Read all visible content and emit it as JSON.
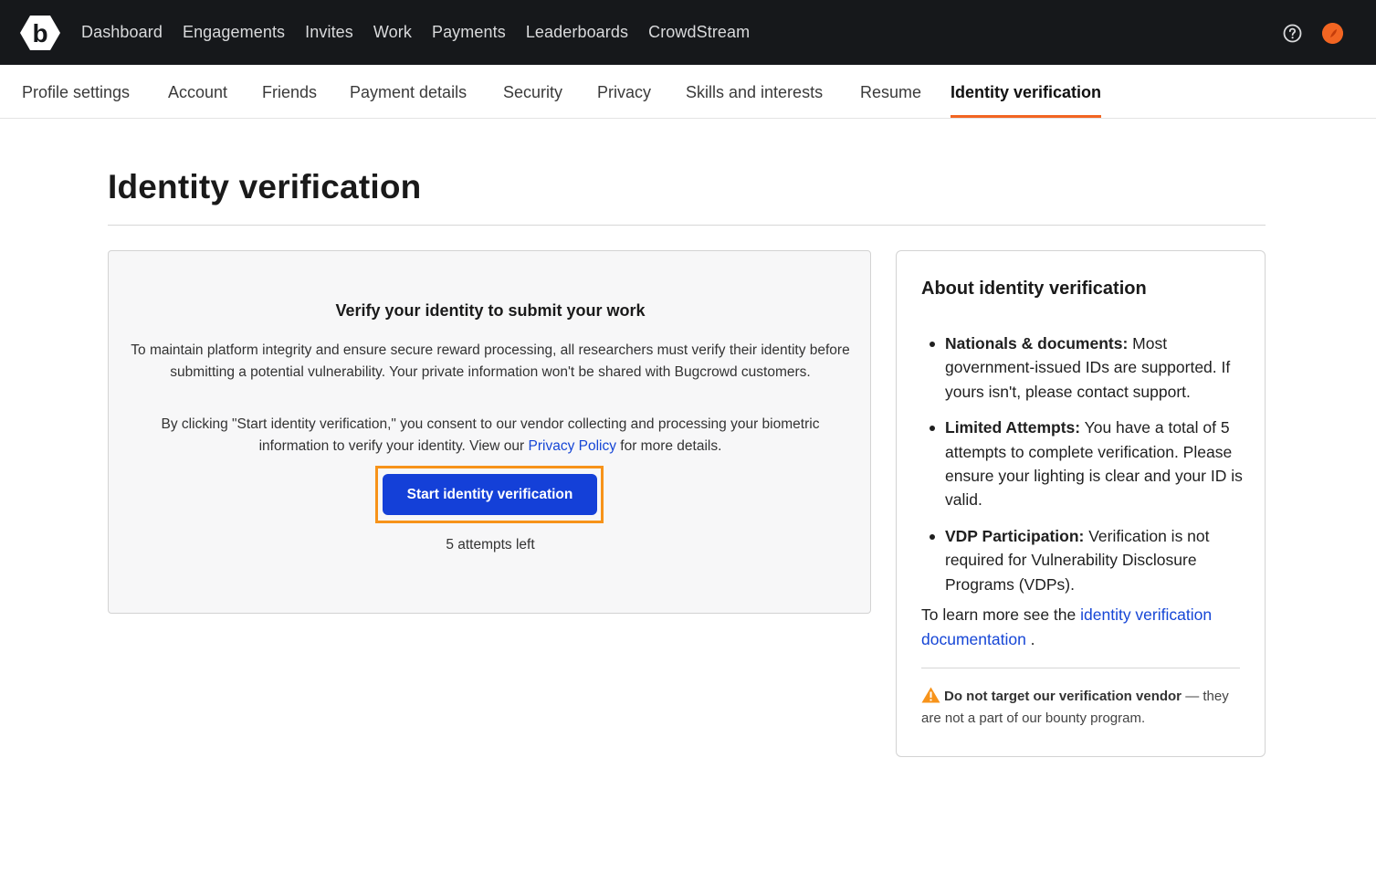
{
  "topnav": {
    "items": [
      "Dashboard",
      "Engagements",
      "Invites",
      "Work",
      "Payments",
      "Leaderboards",
      "CrowdStream"
    ],
    "logo_icon": "bugcrowd-logo-icon",
    "help_icon": "help-circle-icon",
    "avatar_color": "#f26522"
  },
  "subnav": {
    "items": [
      "Profile settings",
      "Account",
      "Friends",
      "Payment details",
      "Security",
      "Privacy",
      "Skills and interests",
      "Resume",
      "Identity verification"
    ],
    "active": "Identity verification",
    "accent": "#f26522"
  },
  "page": {
    "title": "Identity verification"
  },
  "main_card": {
    "heading": "Verify your identity to submit your work",
    "para1": "To maintain platform integrity and ensure secure reward processing, all researchers must verify their identity before submitting a potential vulnerability. Your private information won't be shared with Bugcrowd customers.",
    "para2_before": "By clicking \"Start identity verification,\" you consent to our vendor collecting and processing your biometric information to verify your identity. View our ",
    "para2_link": "Privacy Policy",
    "para2_after": " for more details.",
    "button_label": "Start identity verification",
    "button_color": "#1440d8",
    "attempts_text": "5 attempts left"
  },
  "side_card": {
    "title": "About identity verification",
    "items": [
      {
        "bold": "Nationals & documents:",
        "text": " Most government-issued IDs are supported. If yours isn't, please contact support."
      },
      {
        "bold": "Limited Attempts:",
        "text": " You have a total of 5 attempts to complete verification. Please ensure your lighting is clear and your ID is valid."
      },
      {
        "bold": "VDP Participation:",
        "text": " Verification is not required for Vulnerability Disclosure Programs (VDPs)."
      }
    ],
    "learn_more_before": "To learn more see the ",
    "learn_more_link": "identity verification documentation",
    "learn_more_after": " .",
    "warning_bold": "Do not target our verification vendor",
    "warning_text": " — they are not a part of our bounty program.",
    "warning_icon": "warning-triangle-icon",
    "warning_color": "#f7931a"
  }
}
